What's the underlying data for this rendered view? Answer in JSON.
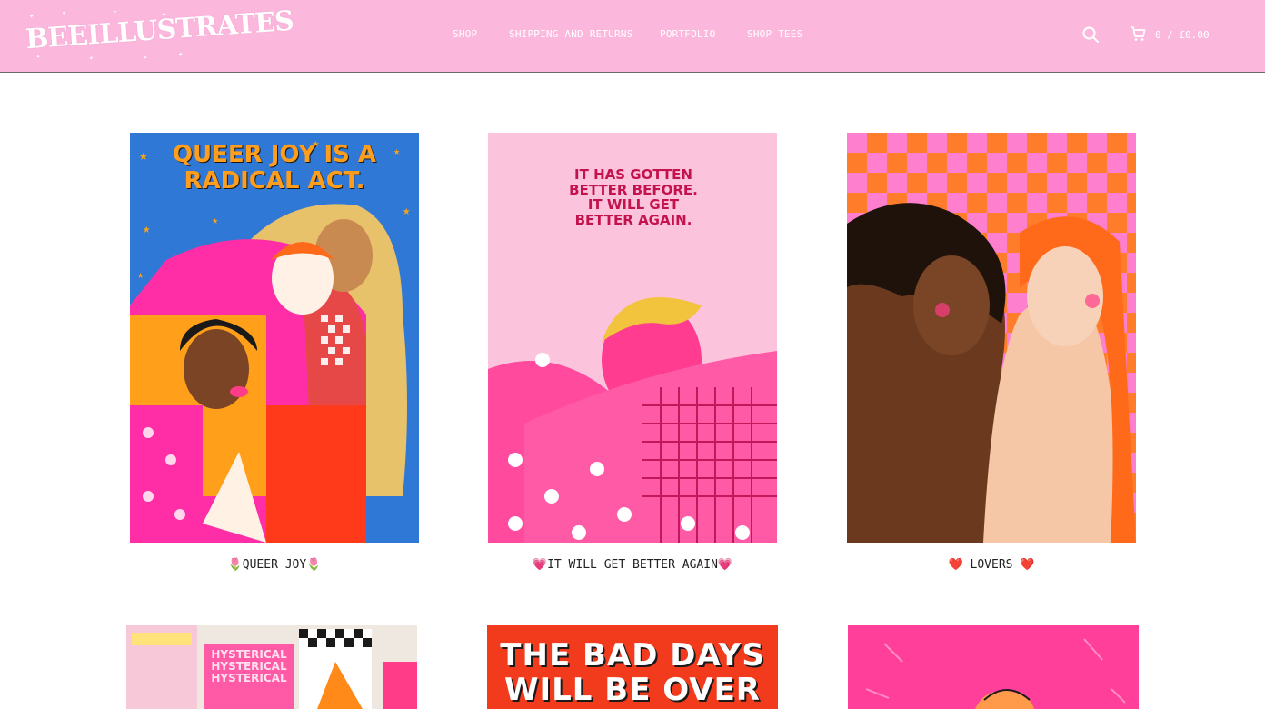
{
  "header": {
    "logo_text": "BEEILLUSTRATES",
    "nav": [
      "SHOP",
      "SHIPPING AND RETURNS",
      "PORTFOLIO",
      "SHOP TEES"
    ],
    "cart_text": "0 / £0.00"
  },
  "products": [
    {
      "title": "🌷QUEER JOY🌷",
      "art_text": [
        "QUEER JOY IS A",
        "RADICAL ACT."
      ]
    },
    {
      "title": "💗IT WILL GET BETTER AGAIN💗",
      "art_text": [
        "IT HAS GOTTEN",
        "BETTER BEFORE.",
        "IT WILL GET",
        "BETTER AGAIN."
      ]
    },
    {
      "title": "❤️ LOVERS ❤️"
    },
    {
      "art_text": [
        "HYSTERICAL",
        "HYSTERICAL",
        "HYSTERICAL"
      ]
    },
    {
      "art_text": [
        "THE BAD DAYS",
        "WILL BE OVER SOON"
      ]
    },
    {}
  ],
  "colors": {
    "header_bg": "#fbb7dc",
    "poster1_bg": "#2f78d6",
    "poster2_bg": "#fbc3dc",
    "poster3_check": "#ff7fcf",
    "poster5_bg": "#f23a1c",
    "poster6_bg": "#ff3f9a"
  }
}
